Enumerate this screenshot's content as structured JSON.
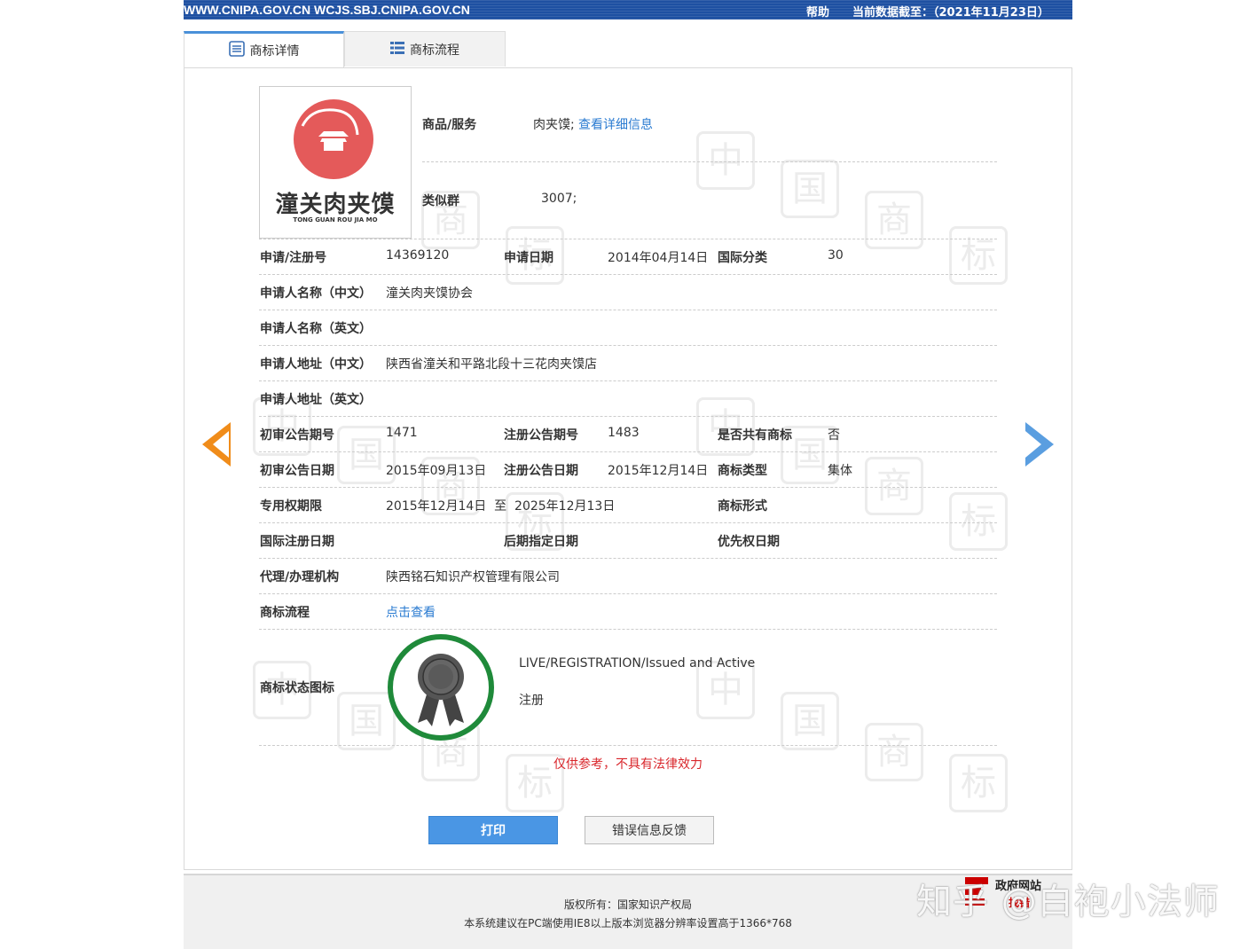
{
  "topbar": {
    "url": "WWW.CNIPA.GOV.CN WCJS.SBJ.CNIPA.GOV.CN",
    "help": "帮助",
    "data_date": "当前数据截至：（2021年11月23日）"
  },
  "tabs": [
    {
      "label": "商标详情",
      "icon": "document-list-icon",
      "active": true
    },
    {
      "label": "商标流程",
      "icon": "list-icon",
      "active": false
    }
  ],
  "logo": {
    "text": "潼关肉夹馍",
    "subtext": "TONG GUAN ROU JIA MO"
  },
  "goods": {
    "label": "商品/服务",
    "value": "肉夹馍;",
    "link": "查看详细信息"
  },
  "similar": {
    "label": "类似群",
    "value": "3007;"
  },
  "fields": {
    "reg_no": {
      "label": "申请/注册号",
      "value": "14369120"
    },
    "app_date": {
      "label": "申请日期",
      "value": "2014年04月14日"
    },
    "intl_class": {
      "label": "国际分类",
      "value": "30"
    },
    "name_cn": {
      "label": "申请人名称（中文）",
      "value": "潼关肉夹馍协会"
    },
    "name_en": {
      "label": "申请人名称（英文）",
      "value": ""
    },
    "addr_cn": {
      "label": "申请人地址（中文）",
      "value": "陕西省潼关和平路北段十三花肉夹馍店"
    },
    "addr_en": {
      "label": "申请人地址（英文）",
      "value": ""
    },
    "prelim_no": {
      "label": "初审公告期号",
      "value": "1471"
    },
    "reg_pub_no": {
      "label": "注册公告期号",
      "value": "1483"
    },
    "shared": {
      "label": "是否共有商标",
      "value": "否"
    },
    "prelim_date": {
      "label": "初审公告日期",
      "value": "2015年09月13日"
    },
    "reg_pub_date": {
      "label": "注册公告日期",
      "value": "2015年12月14日"
    },
    "tm_type": {
      "label": "商标类型",
      "value": "集体"
    },
    "term": {
      "label": "专用权期限",
      "value": "2015年12月14日  至  2025年12月13日"
    },
    "tm_form": {
      "label": "商标形式",
      "value": ""
    },
    "intl_reg_date": {
      "label": "国际注册日期",
      "value": ""
    },
    "later_date": {
      "label": "后期指定日期",
      "value": ""
    },
    "priority_date": {
      "label": "优先权日期",
      "value": ""
    },
    "agent": {
      "label": "代理/办理机构",
      "value": "陕西铭石知识产权管理有限公司"
    },
    "flow": {
      "label": "商标流程",
      "value": "点击查看"
    }
  },
  "status": {
    "label": "商标状态图标",
    "en": "LIVE/REGISTRATION/Issued and Active",
    "cn": "注册"
  },
  "disclaimer": "仅供参考，不具有法律效力",
  "buttons": {
    "print": "打印",
    "feedback": "错误信息反馈"
  },
  "footer": {
    "copyright": "版权所有：国家知识产权局",
    "note": "本系统建议在PC端使用IE8以上版本浏览器分辨率设置高于1366*768"
  },
  "gov_badge": {
    "line1": "政府网站",
    "line2": "找错"
  },
  "watermark_overlay": "知乎 @白袍小法师",
  "watermark_chars": [
    "中",
    "国",
    "商",
    "标"
  ],
  "colors": {
    "topbar": "#1e50a2",
    "link": "#2a7bd1",
    "disclaimer": "#d9262b",
    "print_button": "#4a96e4",
    "badge_ring": "#1f8a3a",
    "arrow_left": "#f08c1a",
    "arrow_right": "#5a9ee0"
  }
}
